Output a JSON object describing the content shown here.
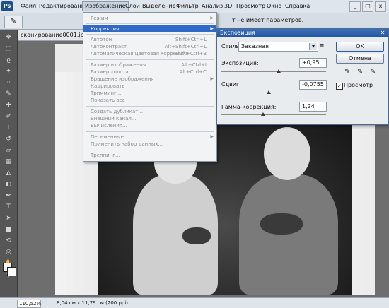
{
  "menubar": {
    "logo": "Ps",
    "items": [
      "Файл",
      "Редактирование",
      "Изображение",
      "Слои",
      "Выделение",
      "Фильтр",
      "Анализ",
      "3D",
      "Просмотр",
      "Окно",
      "Справка"
    ],
    "window_controls": [
      "_",
      "□",
      "x"
    ]
  },
  "options_bar": {
    "text": "т не имеет параметров."
  },
  "document": {
    "tab_title": "сканирование0001.jpg @",
    "zoom": "110,52%",
    "size": "8,04 см x 11,79 см (200 ppi)"
  },
  "image_menu": {
    "items": [
      {
        "label": "Режим",
        "shortcut": "",
        "submenu": true
      },
      {
        "label": "Коррекция",
        "shortcut": "",
        "submenu": true,
        "highlighted": true
      },
      {
        "label": "Автотон",
        "shortcut": "Shift+Ctrl+L"
      },
      {
        "label": "Автоконтраст",
        "shortcut": "Alt+Shift+Ctrl+L"
      },
      {
        "label": "Автоматическая цветовая коррекция",
        "shortcut": "Shift+Ctrl+B"
      },
      {
        "label": "Размер изображения...",
        "shortcut": "Alt+Ctrl+I"
      },
      {
        "label": "Размер холста...",
        "shortcut": "Alt+Ctrl+C"
      },
      {
        "label": "Вращение изображения",
        "shortcut": "",
        "submenu": true
      },
      {
        "label": "Кадрировать",
        "shortcut": ""
      },
      {
        "label": "Тримминг...",
        "shortcut": ""
      },
      {
        "label": "Показать все",
        "shortcut": ""
      },
      {
        "label": "Создать дубликат...",
        "shortcut": ""
      },
      {
        "label": "Внешний канал...",
        "shortcut": ""
      },
      {
        "label": "Вычисления...",
        "shortcut": ""
      },
      {
        "label": "Переменные",
        "shortcut": "",
        "submenu": true
      },
      {
        "label": "Применить набор данных...",
        "shortcut": ""
      },
      {
        "label": "Треппинг...",
        "shortcut": ""
      }
    ]
  },
  "exposure_dialog": {
    "title": "Экспозиция",
    "style_label": "Стиль:",
    "style_value": "Заказная",
    "exposure_label": "Экспозиция:",
    "exposure_value": "+0,95",
    "exposure_level": 0.55,
    "offset_label": "Сдвиг:",
    "offset_value": "-0,0755",
    "offset_level": 0.45,
    "gamma_label": "Гамма-коррекция:",
    "gamma_value": "1,24",
    "gamma_level": 0.4,
    "ok_label": "OK",
    "cancel_label": "Отмена",
    "preview_label": "Просмотр",
    "preview_checked": "✓"
  },
  "colors": {
    "accent": "#3169c6",
    "dialog_title": "#2456a0"
  }
}
